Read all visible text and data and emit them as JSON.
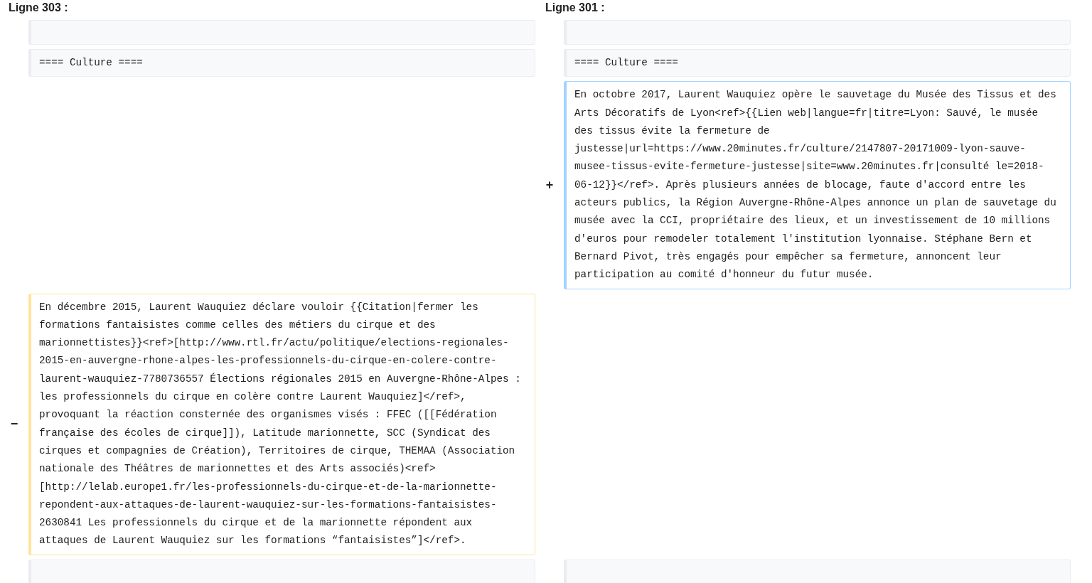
{
  "headers": [
    "Ligne 303 :",
    "Ligne 301 :"
  ],
  "rows": [
    {
      "kind": "context"
    },
    {
      "kind": "context",
      "left": "==== Culture ====",
      "right": "==== Culture ===="
    },
    {
      "kind": "added",
      "marker": "+",
      "text": "En octobre 2017, Laurent Wauquiez opère le sauvetage du Musée des Tissus et des Arts Décoratifs de Lyon<ref>{{Lien web|langue=fr|titre=Lyon: Sauvé, le musée des tissus évite la fermeture de justesse|url=https://www.20minutes.fr/culture/2147807-20171009-lyon-sauve-musee-tissus-evite-fermeture-justesse|site=www.20minutes.fr|consulté le=2018-06-12}}</ref>. Après plusieurs années de blocage, faute d'accord entre les acteurs publics, la Région Auvergne-Rhône-Alpes annonce un plan de sauvetage du musée avec la CCI, propriétaire des lieux, et un investissement de 10 millions d'euros pour remodeler totalement l'institution lyonnaise. Stéphane Bern et Bernard Pivot, très engagés pour empêcher sa fermeture, annoncent leur participation au comité d'honneur du futur musée."
    },
    {
      "kind": "deleted",
      "marker": "−",
      "text": "En décembre 2015, Laurent Wauquiez déclare vouloir {{Citation|fermer les formations fantaisistes comme celles des métiers du cirque et des marionnettistes}}<ref>[http://www.rtl.fr/actu/politique/elections-regionales-2015-en-auvergne-rhone-alpes-les-professionnels-du-cirque-en-colere-contre-laurent-wauquiez-7780736557 Élections régionales 2015 en Auvergne-Rhône-Alpes : les professionnels du cirque en colère contre Laurent Wauquiez]</ref>, provoquant la réaction consternée des organismes visés : FFEC ([[Fédération française des écoles de cirque]]), Latitude marionnette, SCC (Syndicat des cirques et compagnies de Création), Territoires de cirque, THEMAA (Association nationale des Théâtres de marionnettes et des Arts associés)<ref>[http://lelab.europe1.fr/les-professionnels-du-cirque-et-de-la-marionnette-repondent-aux-attaques-de-laurent-wauquiez-sur-les-formations-fantaisistes-2630841 Les professionnels du cirque et de la marionnette répondent aux attaques de Laurent Wauquiez sur les formations “fantaisistes”]</ref>."
    },
    {
      "kind": "context"
    }
  ]
}
